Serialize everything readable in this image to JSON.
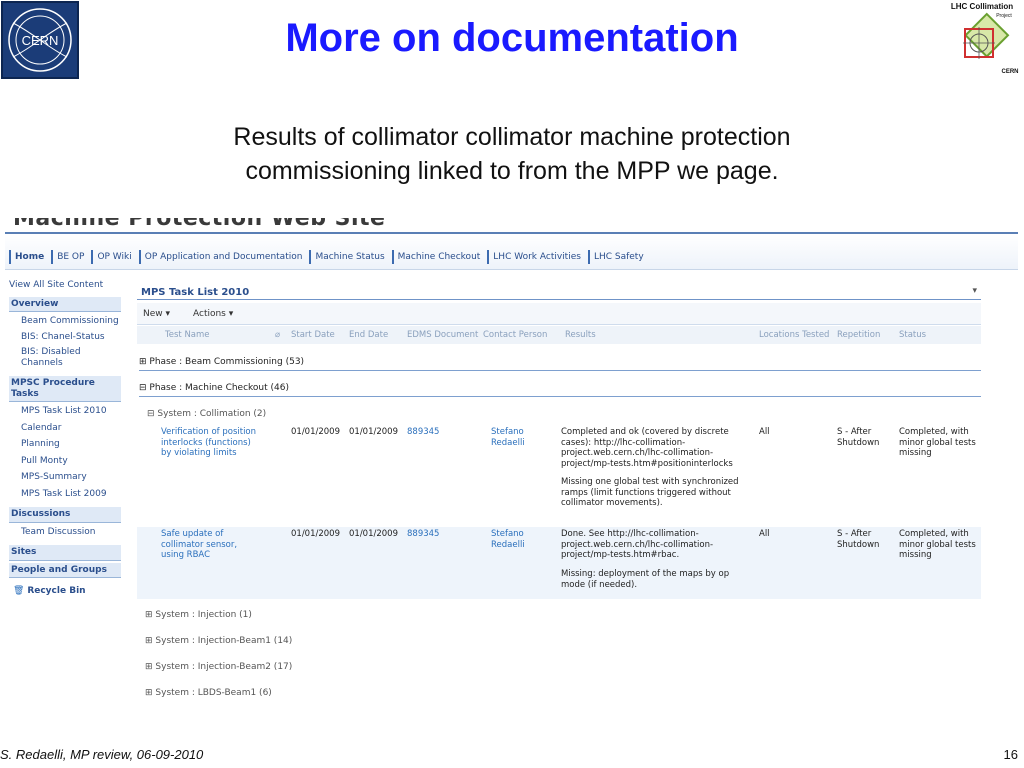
{
  "slide": {
    "title": "More on documentation",
    "subtitle": "Results of collimator collimator machine protection commissioning linked to from the MPP we page.",
    "footer_left": "S. Redaelli, MP review, 06-09-2010",
    "page_number": "16",
    "cern_logo_text": "CERN",
    "lhc_logo_text": [
      "LHC Collimation",
      "Project",
      "CERN"
    ]
  },
  "site": {
    "banner": "Machine Protection Web Site",
    "nav": [
      "Home",
      "BE OP",
      "OP Wiki",
      "OP Application and Documentation",
      "Machine Status",
      "Machine Checkout",
      "LHC Work Activities",
      "LHC Safety"
    ],
    "left_nav": {
      "view_all": "View All Site Content",
      "overview_heading": "Overview",
      "overview_items": [
        "Beam Commissioning",
        "BIS: Chanel-Status",
        "BIS: Disabled Channels"
      ],
      "mpsc_heading": "MPSC Procedure Tasks",
      "mpsc_items": [
        "MPS Task List 2010",
        "Calendar",
        "Planning",
        "Pull Monty",
        "MPS-Summary",
        "MPS Task List 2009"
      ],
      "discussions_heading": "Discussions",
      "discussion_items": [
        "Team Discussion"
      ],
      "sites_heading": "Sites",
      "people_heading": "People and Groups",
      "recycle_bin": "Recycle Bin"
    },
    "list": {
      "title": "MPS Task List 2010",
      "toolbar": {
        "new_label": "New ▾",
        "actions_label": "Actions ▾"
      },
      "columns": [
        "Test Name",
        "Start Date",
        "End Date",
        "EDMS Document",
        "Contact Person",
        "Results",
        "Locations Tested",
        "Repetition",
        "Status"
      ],
      "phase_beam": "⊞ Phase : Beam Commissioning (53)",
      "phase_checkout": "⊟ Phase : Machine Checkout (46)",
      "sys_collimation": "⊟ System : Collimation (2)",
      "rows": [
        {
          "test_name": "Verification of position interlocks (functions) by violating limits",
          "start": "01/01/2009",
          "end": "01/01/2009",
          "edms": "889345",
          "contact": "Stefano Redaelli",
          "results_1": "Completed and ok (covered by discrete cases): http://lhc-collimation-project.web.cern.ch/lhc-collimation-project/mp-tests.htm#positioninterlocks",
          "results_2": "Missing one global test with synchronized ramps (limit functions triggered without collimator movements).",
          "locations": "All",
          "repetition": "S - After Shutdown",
          "status": "Completed, with minor global tests missing"
        },
        {
          "test_name": "Safe update of collimator sensor, using RBAC",
          "start": "01/01/2009",
          "end": "01/01/2009",
          "edms": "889345",
          "contact": "Stefano Redaelli",
          "results_1": "Done. See http://lhc-collimation-project.web.cern.ch/lhc-collimation-project/mp-tests.htm#rbac.",
          "results_2": "Missing: deployment of the maps by op mode (if needed).",
          "locations": "All",
          "repetition": "S - After Shutdown",
          "status": "Completed, with minor global tests missing"
        }
      ],
      "systems_collapsed": [
        "⊞ System : Injection (1)",
        "⊞ System : Injection-Beam1 (14)",
        "⊞ System : Injection-Beam2 (17)",
        "⊞ System : LBDS-Beam1 (6)"
      ]
    }
  },
  "colors": {
    "title": "#1a1aff",
    "link": "#2a4e8c",
    "cern_blue": "#1b3c78"
  }
}
